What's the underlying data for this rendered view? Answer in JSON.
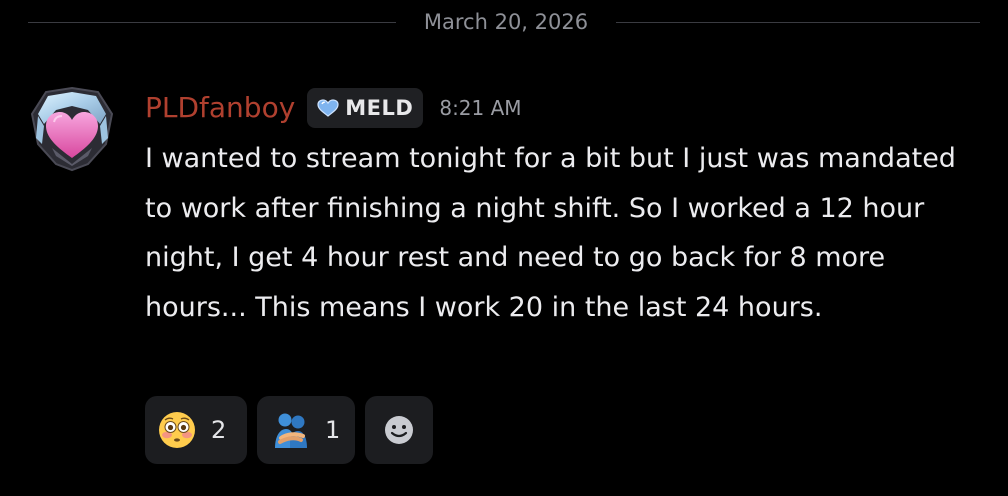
{
  "divider": {
    "date": "March 20, 2026"
  },
  "message": {
    "username": "PLDfanboy",
    "username_color": "#b0402f",
    "tag": "MELD",
    "timestamp": "8:21 AM",
    "text": "I wanted to stream tonight for a bit but I just was mandated to work after finishing a night shift. So I worked a 12 hour night, I get 4 hour rest and need to go back for 8 more hours... This means I work 20 in the last 24 hours.",
    "avatar_icon": "heart-crest-icon"
  },
  "reactions": [
    {
      "emoji": "flushed-face-icon",
      "count": "2"
    },
    {
      "emoji": "people-hugging-icon",
      "count": "1"
    }
  ],
  "add_reaction": {
    "icon": "add-reaction-smiley-icon"
  }
}
